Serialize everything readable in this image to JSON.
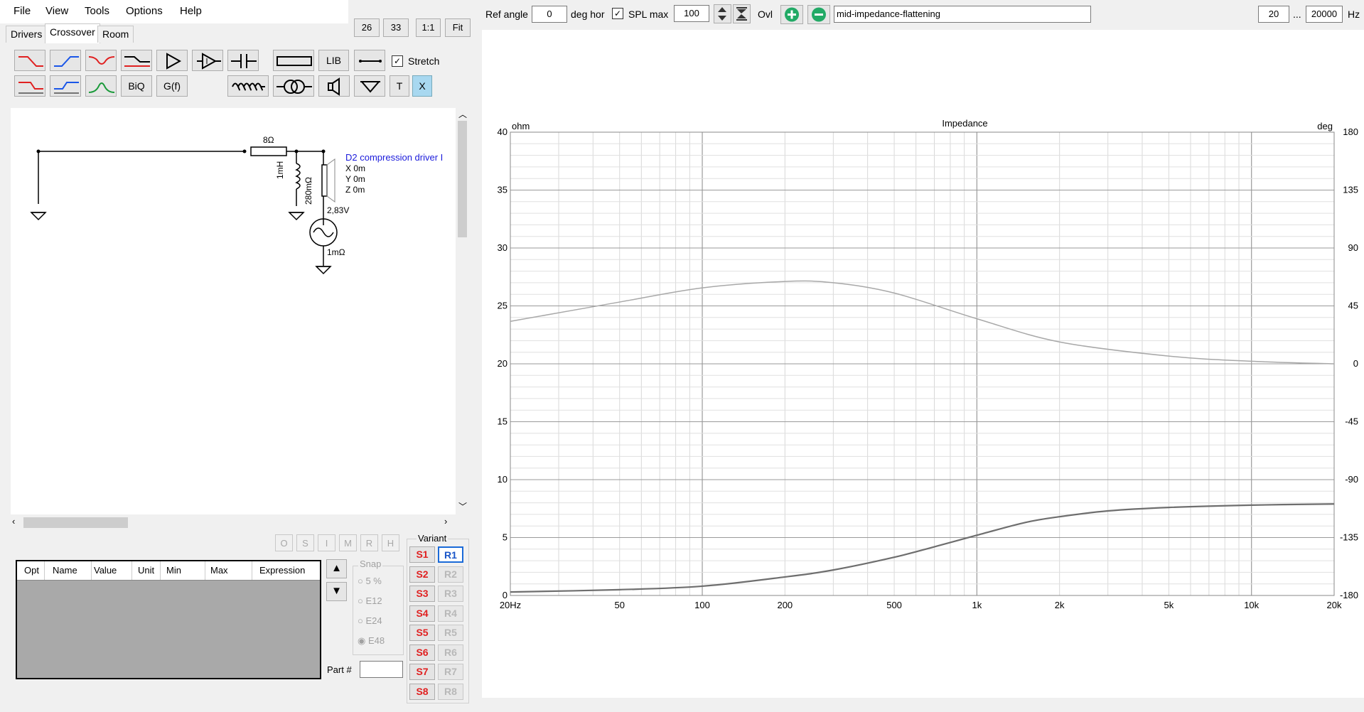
{
  "menu": [
    "File",
    "View",
    "Tools",
    "Options",
    "Help"
  ],
  "tabs": [
    "Drivers",
    "Crossover",
    "Room"
  ],
  "zoom_buttons": [
    "26",
    "33",
    "1:1",
    "Fit"
  ],
  "toolbar": {
    "lib_label": "LIB",
    "biq_label": "BiQ",
    "gf_label": "G(f)",
    "t_label": "T",
    "x_label": "X",
    "stretch_label": "Stretch",
    "stretch_checked": true
  },
  "schematic": {
    "resistor_label": "8Ω",
    "inductor_label": "1mH",
    "inductor_res_label": "280mΩ",
    "driver_name": "D2 compression driver I",
    "driver_x": "X 0m",
    "driver_y": "Y 0m",
    "driver_z": "Z 0m",
    "source_voltage": "2,83V",
    "source_res": "1mΩ"
  },
  "param_buttons": [
    "O",
    "S",
    "I",
    "M",
    "R",
    "H"
  ],
  "param_table": {
    "columns": [
      "Opt",
      "Name",
      "Value",
      "Unit",
      "Min",
      "Max",
      "Expression"
    ]
  },
  "snap": {
    "title": "Snap",
    "options": [
      "5 %",
      "E12",
      "E24",
      "E48"
    ],
    "selected": "E48"
  },
  "part_label": "Part #",
  "part_value": "",
  "variant": {
    "title": "Variant",
    "s": [
      "S1",
      "S2",
      "S3",
      "S4",
      "S5",
      "S6",
      "S7",
      "S8"
    ],
    "r": [
      "R1",
      "R2",
      "R3",
      "R4",
      "R5",
      "R6",
      "R7",
      "R8"
    ],
    "active_r": "R1"
  },
  "topbar": {
    "ref_angle_label": "Ref angle",
    "ref_angle_value": "0",
    "deg_hor_label": "deg hor",
    "spl_max_label": "SPL max",
    "spl_max_checked": true,
    "spl_max_value": "100",
    "ovl_label": "Ovl",
    "overlay_name": "mid-impedance-flattening",
    "freq_min": "20",
    "freq_sep": "...",
    "freq_max": "20000",
    "hz_label": "Hz"
  },
  "colors": {
    "resistor_accent": "#e02020",
    "highpass_accent": "#1a56e8",
    "bandpass_accent": "#1a9a3a",
    "plus_minus_button": "#22aa66",
    "driver_text": "#1a1adb",
    "x_button_bg": "#a8d8f0"
  },
  "chart_data": {
    "type": "line",
    "title": "Impedance",
    "y_unit_left": "ohm",
    "y_unit_right": "deg",
    "x_scale": "log",
    "xlim": [
      20,
      20000
    ],
    "ylim": [
      0,
      40
    ],
    "y2lim": [
      -180,
      180
    ],
    "grid": true,
    "x_ticks": [
      "20Hz",
      "50",
      "100",
      "200",
      "500",
      "1k",
      "2k",
      "5k",
      "10k",
      "20k"
    ],
    "y_ticks": [
      "0",
      "5",
      "10",
      "15",
      "20",
      "25",
      "30",
      "35",
      "40"
    ],
    "y2_ticks": [
      "-180",
      "-135",
      "-90",
      "-45",
      "0",
      "45",
      "90",
      "135",
      "180"
    ],
    "series": [
      {
        "axis": "left",
        "x": [
          20,
          50,
          100,
          200,
          300,
          500,
          700,
          1000,
          1500,
          2000,
          3000,
          5000,
          10000,
          20000
        ],
        "y": [
          0.3,
          0.5,
          0.8,
          1.6,
          2.2,
          3.3,
          4.2,
          5.2,
          6.3,
          6.8,
          7.3,
          7.6,
          7.8,
          7.9
        ],
        "color": "#6e6e6e"
      },
      {
        "axis": "right",
        "x": [
          20,
          50,
          100,
          200,
          300,
          500,
          1000,
          2000,
          5000,
          10000,
          20000
        ],
        "y": [
          33,
          48,
          59,
          64,
          63,
          55,
          35,
          17,
          6,
          2,
          0
        ],
        "color": "#a8a8a8"
      }
    ]
  }
}
